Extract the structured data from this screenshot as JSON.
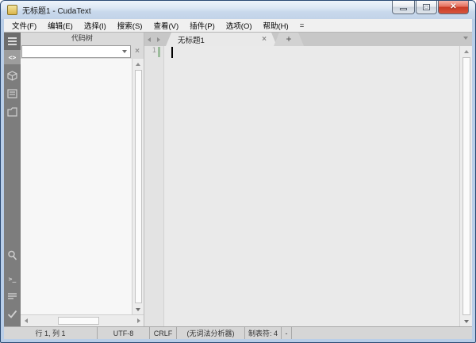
{
  "titlebar": {
    "title": "无标题1 - CudaText"
  },
  "menubar": {
    "items": [
      "文件(F)",
      "编辑(E)",
      "选择(I)",
      "搜索(S)",
      "查看(V)",
      "插件(P)",
      "选项(O)",
      "帮助(H)",
      "="
    ]
  },
  "sidebar": {
    "icons_top": [
      "menu-icon",
      "code-tree-icon",
      "project-icon",
      "tabs-list-icon",
      "file-icon"
    ],
    "icons_bottom": [
      "search-icon",
      "console-icon",
      "output-icon",
      "validate-icon"
    ],
    "code_tree_glyph": "<>",
    "console_glyph": ">_"
  },
  "code_tree_panel": {
    "title": "代码树",
    "filter_value": "",
    "close_glyph": "×"
  },
  "tabbar": {
    "active_tab": "无标题1",
    "close_glyph": "×",
    "new_tab_glyph": "+"
  },
  "editor": {
    "line_number": "1"
  },
  "statusbar": {
    "caret_pos": "行 1, 列 1",
    "encoding": "UTF-8",
    "line_endings": "CRLF",
    "lexer": "(无词法分析器)",
    "tab_size": "制表符: 4",
    "extra": "-"
  },
  "colors": {
    "titlebar_blue": "#d3e0f0",
    "sidebar_gray": "#7d7d7d",
    "editor_bg": "#eaeaea",
    "marker_green": "#9cbc9c",
    "close_button_red": "#d8553d"
  }
}
